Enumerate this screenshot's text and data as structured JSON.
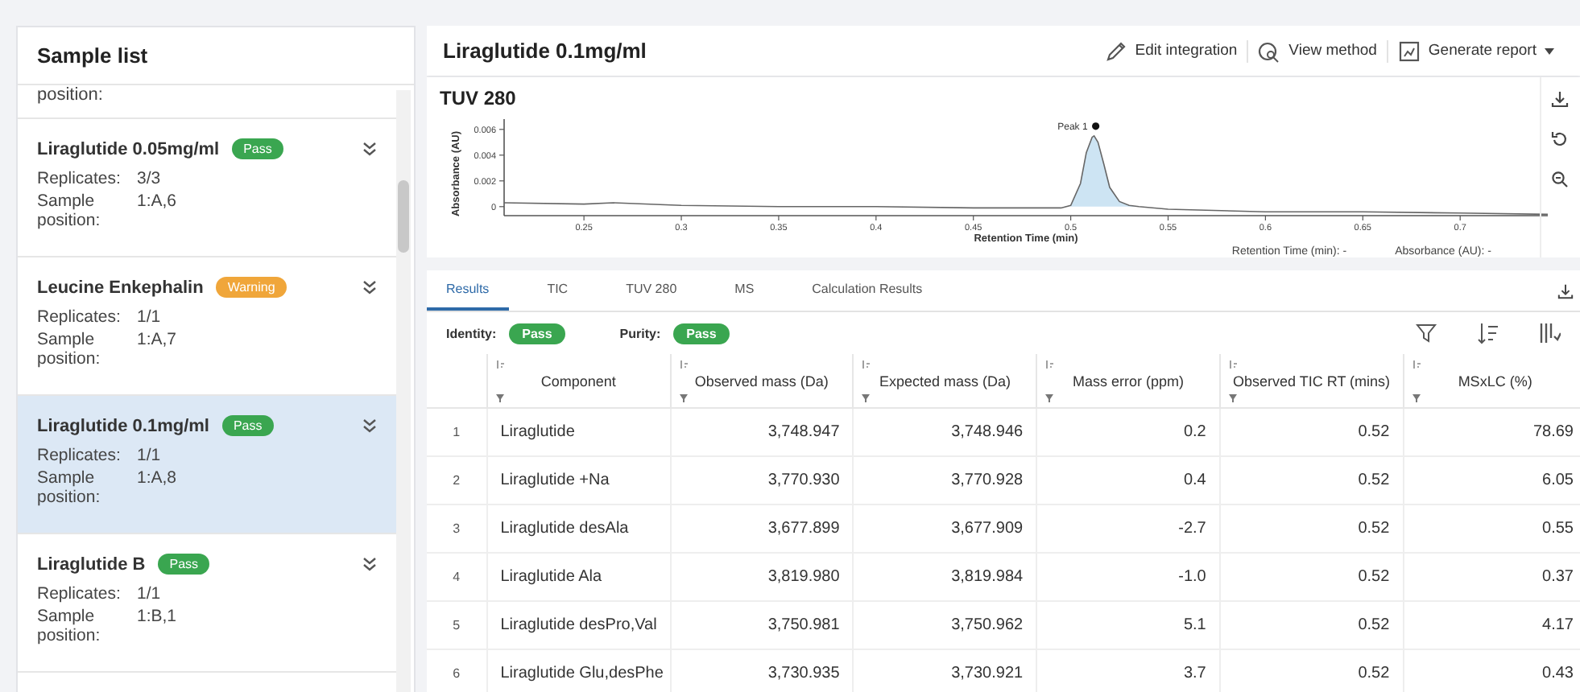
{
  "sidebar": {
    "title": "Sample list",
    "partial_top": {
      "label": "position:"
    },
    "items": [
      {
        "name": "Liraglutide 0.05mg/ml",
        "status": "Pass",
        "color": "#3aa650",
        "selected": false,
        "fields": [
          {
            "label": "Replicates:",
            "value": "3/3"
          },
          {
            "label": "Sample position:",
            "value": "1:A,6"
          }
        ]
      },
      {
        "name": "Leucine Enkephalin",
        "status": "Warning",
        "color": "#f0a63a",
        "selected": false,
        "fields": [
          {
            "label": "Replicates:",
            "value": "1/1"
          },
          {
            "label": "Sample position:",
            "value": "1:A,7"
          }
        ]
      },
      {
        "name": "Liraglutide 0.1mg/ml",
        "status": "Pass",
        "color": "#3aa650",
        "selected": true,
        "fields": [
          {
            "label": "Replicates:",
            "value": "1/1"
          },
          {
            "label": "Sample position:",
            "value": "1:A,8"
          }
        ]
      },
      {
        "name": "Liraglutide B",
        "status": "Pass",
        "color": "#3aa650",
        "selected": false,
        "fields": [
          {
            "label": "Replicates:",
            "value": "1/1"
          },
          {
            "label": "Sample position:",
            "value": "1:B,1"
          }
        ]
      }
    ]
  },
  "header": {
    "title": "Liraglutide 0.1mg/ml",
    "actions": [
      {
        "label": "Edit integration",
        "kind": "edit"
      },
      {
        "label": "View method",
        "kind": "view"
      },
      {
        "label": "Generate report",
        "kind": "report"
      }
    ]
  },
  "chart": {
    "title": "TUV 280",
    "readouts": [
      "Retention Time (min): -",
      "Absorbance (AU): -"
    ],
    "chart_data": {
      "type": "line",
      "xlabel": "Retention Time (min)",
      "ylabel": "Absorbance (AU)",
      "xlim": [
        0.209,
        0.745
      ],
      "ylim": [
        -0.0007,
        0.0068
      ],
      "xticks": [
        0.25,
        0.3,
        0.35,
        0.4,
        0.45,
        0.5,
        0.55,
        0.6,
        0.65,
        0.7
      ],
      "yticks": [
        0,
        0.002,
        0.004,
        0.006
      ],
      "x": [
        0.209,
        0.25,
        0.265,
        0.3,
        0.35,
        0.4,
        0.45,
        0.495,
        0.5,
        0.505,
        0.508,
        0.511,
        0.512,
        0.514,
        0.517,
        0.52,
        0.525,
        0.53,
        0.535,
        0.55,
        0.6,
        0.65,
        0.7,
        0.745
      ],
      "series": [
        {
          "color": "#666666",
          "values": [
            0.0003,
            0.0002,
            0.0003,
            0.0001,
            0.0,
            0.0,
            -0.0001,
            -0.0001,
            0.0001,
            0.0018,
            0.0042,
            0.0054,
            0.0055,
            0.005,
            0.0033,
            0.0015,
            0.0004,
            0.0001,
            0.0,
            -0.0002,
            -0.0004,
            -0.0004,
            -0.0005,
            -0.0006
          ]
        }
      ],
      "annotations": [
        {
          "x": 0.512,
          "y": 0.0055,
          "text": "Peak 1"
        }
      ]
    }
  },
  "tabs": [
    {
      "label": "Results",
      "selected": true
    },
    {
      "label": "TIC",
      "selected": false
    },
    {
      "label": "TUV 280",
      "selected": false
    },
    {
      "label": "MS",
      "selected": false
    },
    {
      "label": "Calculation Results",
      "selected": false
    }
  ],
  "summary": [
    {
      "label": "Identity:",
      "status": "Pass"
    },
    {
      "label": "Purity:",
      "status": "Pass"
    }
  ],
  "table": {
    "columns": [
      "",
      "Component",
      "Observed mass (Da)",
      "Expected mass (Da)",
      "Mass error (ppm)",
      "Observed TIC RT (mins)",
      "MSxLC (%)"
    ],
    "rows": [
      [
        "1",
        "Liraglutide",
        "3,748.947",
        "3,748.946",
        "0.2",
        "0.52",
        "78.69"
      ],
      [
        "2",
        "Liraglutide +Na",
        "3,770.930",
        "3,770.928",
        "0.4",
        "0.52",
        "6.05"
      ],
      [
        "3",
        "Liraglutide desAla",
        "3,677.899",
        "3,677.909",
        "-2.7",
        "0.52",
        "0.55"
      ],
      [
        "4",
        "Liraglutide Ala",
        "3,819.980",
        "3,819.984",
        "-1.0",
        "0.52",
        "0.37"
      ],
      [
        "5",
        "Liraglutide desPro,Val",
        "3,750.981",
        "3,750.962",
        "5.1",
        "0.52",
        "4.17"
      ],
      [
        "6",
        "Liraglutide Glu,desPhe",
        "3,730.935",
        "3,730.921",
        "3.7",
        "0.52",
        "0.43"
      ]
    ]
  }
}
